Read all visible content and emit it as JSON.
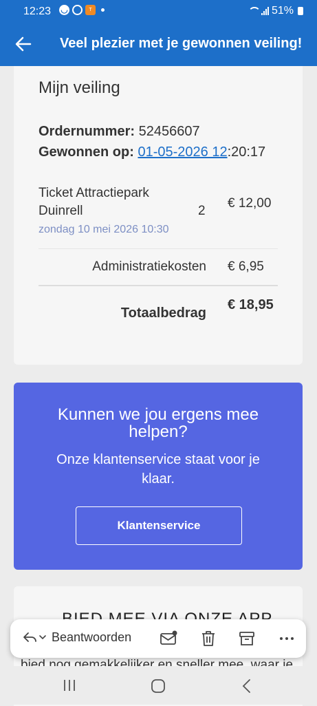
{
  "status_bar": {
    "time": "12:23",
    "battery": "51%"
  },
  "app_bar": {
    "title": "Veel plezier met je gewonnen veiling!"
  },
  "auction": {
    "title": "Mijn veiling",
    "order_label": "Ordernummer:",
    "order_number": "52456607",
    "won_label": "Gewonnen op:",
    "won_date_link": "01-05-2026 12",
    "won_time_rest": ":20:17",
    "item": {
      "name": "Ticket Attractiepark Duinrell",
      "date": "zondag 10 mei 2026 10:30",
      "quantity": "2",
      "price": "€ 12,00"
    },
    "admin_label": "Administratiekosten",
    "admin_value": "€ 6,95",
    "total_label": "Totaalbedrag",
    "total_value": "€ 18,95"
  },
  "help": {
    "title": "Kunnen we jou ergens mee helpen?",
    "text": "Onze klantenservice staat voor je klaar.",
    "button_label": "Klantenservice"
  },
  "app_promo": {
    "heading": "BIED MEE VIA ONZE APP",
    "text": "bied nog gemakkelijker en sneller mee, waar je"
  },
  "reply_toolbar": {
    "reply_label": "Beantwoorden"
  },
  "colors": {
    "brand_blue": "#1d6fc9",
    "help_purple": "#5566e2",
    "date_blue": "#7d8fc4"
  }
}
